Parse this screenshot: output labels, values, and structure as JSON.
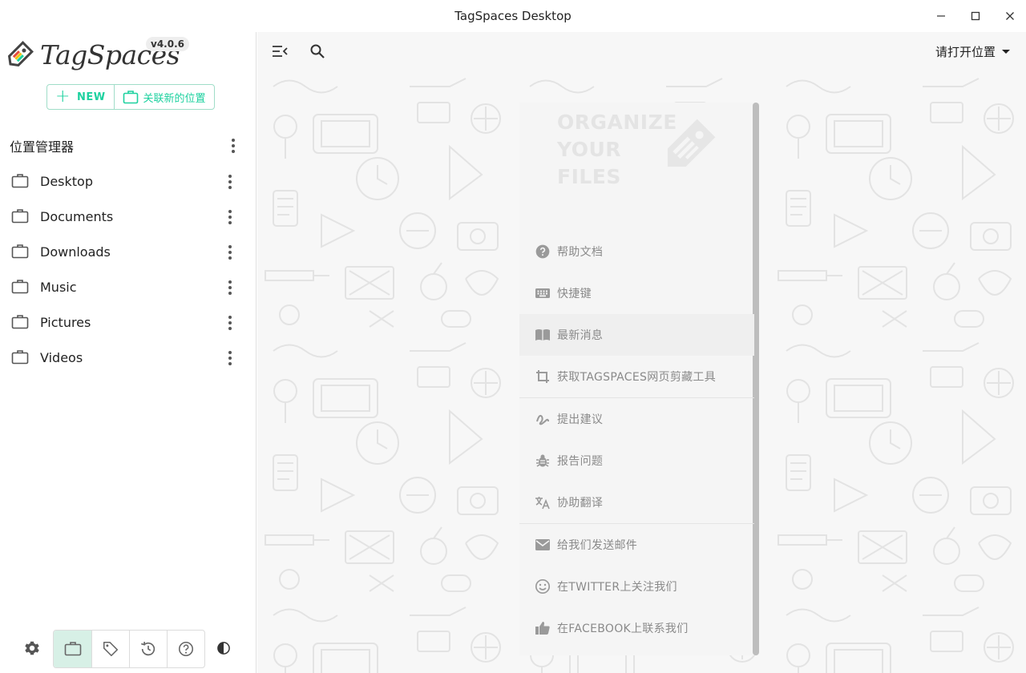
{
  "window": {
    "title": "TagSpaces Desktop"
  },
  "brand": {
    "name": "TagSpaces",
    "version": "v4.0.6"
  },
  "actions": {
    "new_label": "NEW",
    "link_location_label": "关联新的位置"
  },
  "location_manager": {
    "title": "位置管理器",
    "items": [
      {
        "label": "Desktop"
      },
      {
        "label": "Documents"
      },
      {
        "label": "Downloads"
      },
      {
        "label": "Music"
      },
      {
        "label": "Pictures"
      },
      {
        "label": "Videos"
      }
    ]
  },
  "toolbar": {
    "open_location_label": "请打开位置"
  },
  "welcome": {
    "slogan": [
      "ORGANIZE",
      "YOUR",
      "FILES"
    ],
    "menu": [
      {
        "icon": "help-circle-icon",
        "label": "帮助文档"
      },
      {
        "icon": "keyboard-icon",
        "label": "快捷键"
      },
      {
        "icon": "book-icon",
        "label": "最新消息"
      },
      {
        "icon": "crop-icon",
        "label": "获取TAGSPACES网页剪藏工具"
      },
      {
        "icon": "gesture-icon",
        "label": "提出建议"
      },
      {
        "icon": "bug-icon",
        "label": "报告问题"
      },
      {
        "icon": "translate-icon",
        "label": "协助翻译"
      },
      {
        "icon": "email-icon",
        "label": "给我们发送邮件"
      },
      {
        "icon": "smiley-icon",
        "label": "在TWITTER上关注我们"
      },
      {
        "icon": "thumb-up-icon",
        "label": "在FACEBOOK上联系我们"
      }
    ]
  },
  "colors": {
    "accent": "#1dd19f",
    "active_bg": "#d7f0e6",
    "muted_text": "#8a8a8a"
  }
}
